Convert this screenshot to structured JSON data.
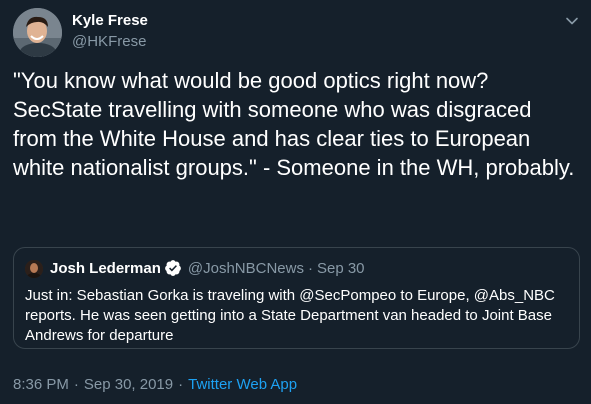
{
  "author": {
    "name": "Kyle Frese",
    "handle": "@HKFrese"
  },
  "tweet": {
    "text": "\"You know what would be good optics right now? SecState travelling with someone who was disgraced from the White House and has clear ties to European white nationalist groups.\" - Someone in the WH, probably."
  },
  "quoted": {
    "name": "Josh Lederman",
    "handle": "@JoshNBCNews",
    "separator": "·",
    "date": "Sep 30",
    "text": "Just in: Sebastian Gorka is traveling with @SecPompeo to Europe, @Abs_NBC reports. He was seen getting into a State Department van headed to Joint Base Andrews for departure"
  },
  "footer": {
    "time": "8:36 PM",
    "separator": "·",
    "date": "Sep 30, 2019",
    "source": "Twitter Web App"
  },
  "colors": {
    "background": "#15202b",
    "primary_text": "#ffffff",
    "secondary_text": "#8899a6",
    "link": "#1da1f2",
    "border": "#38444d"
  },
  "icons": {
    "caret": "chevron-down-icon",
    "verified": "verified-badge-icon"
  }
}
